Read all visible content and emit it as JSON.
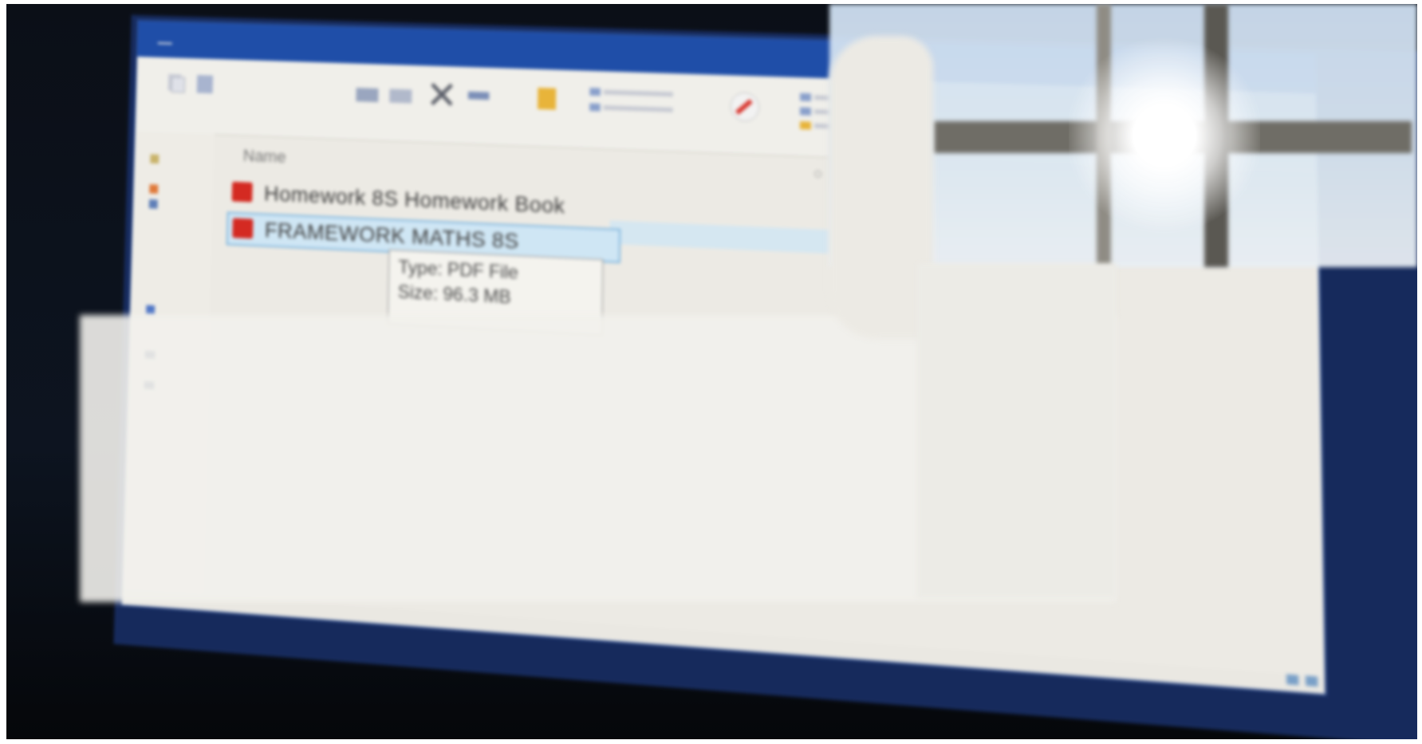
{
  "window": {
    "title": "",
    "quick_access": "",
    "tabs": [
      {
        "label": "",
        "active": true
      },
      {
        "label": "",
        "active": false
      },
      {
        "label": "",
        "active": false
      },
      {
        "label": "",
        "active": false
      }
    ]
  },
  "file_list": {
    "column_header": "Name",
    "rows": [
      {
        "name": "Homework 8S Homework Book",
        "type_icon": "pdf-icon",
        "selected": false
      },
      {
        "name": "FRAMEWORK MATHS 8S",
        "type_icon": "pdf-icon",
        "selected": true
      }
    ]
  },
  "tooltip": {
    "type_line": "Type: PDF File",
    "size_line": "Size: 96.3 MB"
  },
  "colors": {
    "accent_blue": "#1f4ea8",
    "selection": "#cfe6f4",
    "pdf_red": "#d42a22",
    "window_bg": "#eceae4"
  }
}
